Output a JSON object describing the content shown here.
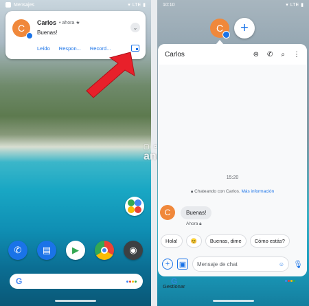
{
  "left": {
    "status": {
      "app": "Mensajes",
      "network": "LTE"
    },
    "notification": {
      "avatar_letter": "C",
      "sender": "Carlos",
      "time": "ahora",
      "message": "Buenas!",
      "actions": [
        "Leído",
        "Respon...",
        "Record..."
      ]
    },
    "watermark": {
      "small": "▢ ¤ + ∃",
      "brand": "android"
    }
  },
  "right": {
    "status": {
      "time": "10:10",
      "network": "LTE"
    },
    "bubble_letter": "C",
    "plus": "+",
    "chat": {
      "contact": "Carlos",
      "timestamp": "15:20",
      "info_text": "Chateando con Carlos.",
      "info_link": "Más información",
      "avatar_letter": "C",
      "message": "Buenas!",
      "message_time": "Ahora",
      "suggestions": [
        "Hola!",
        "😊",
        "Buenas, dime",
        "Cómo estás?"
      ],
      "placeholder": "Mensaje de chat"
    },
    "manage_label": "Gestionar"
  },
  "colors": {
    "accent": "#1a73e8",
    "avatar": "#f0883b",
    "arrow": "#e8202a"
  }
}
